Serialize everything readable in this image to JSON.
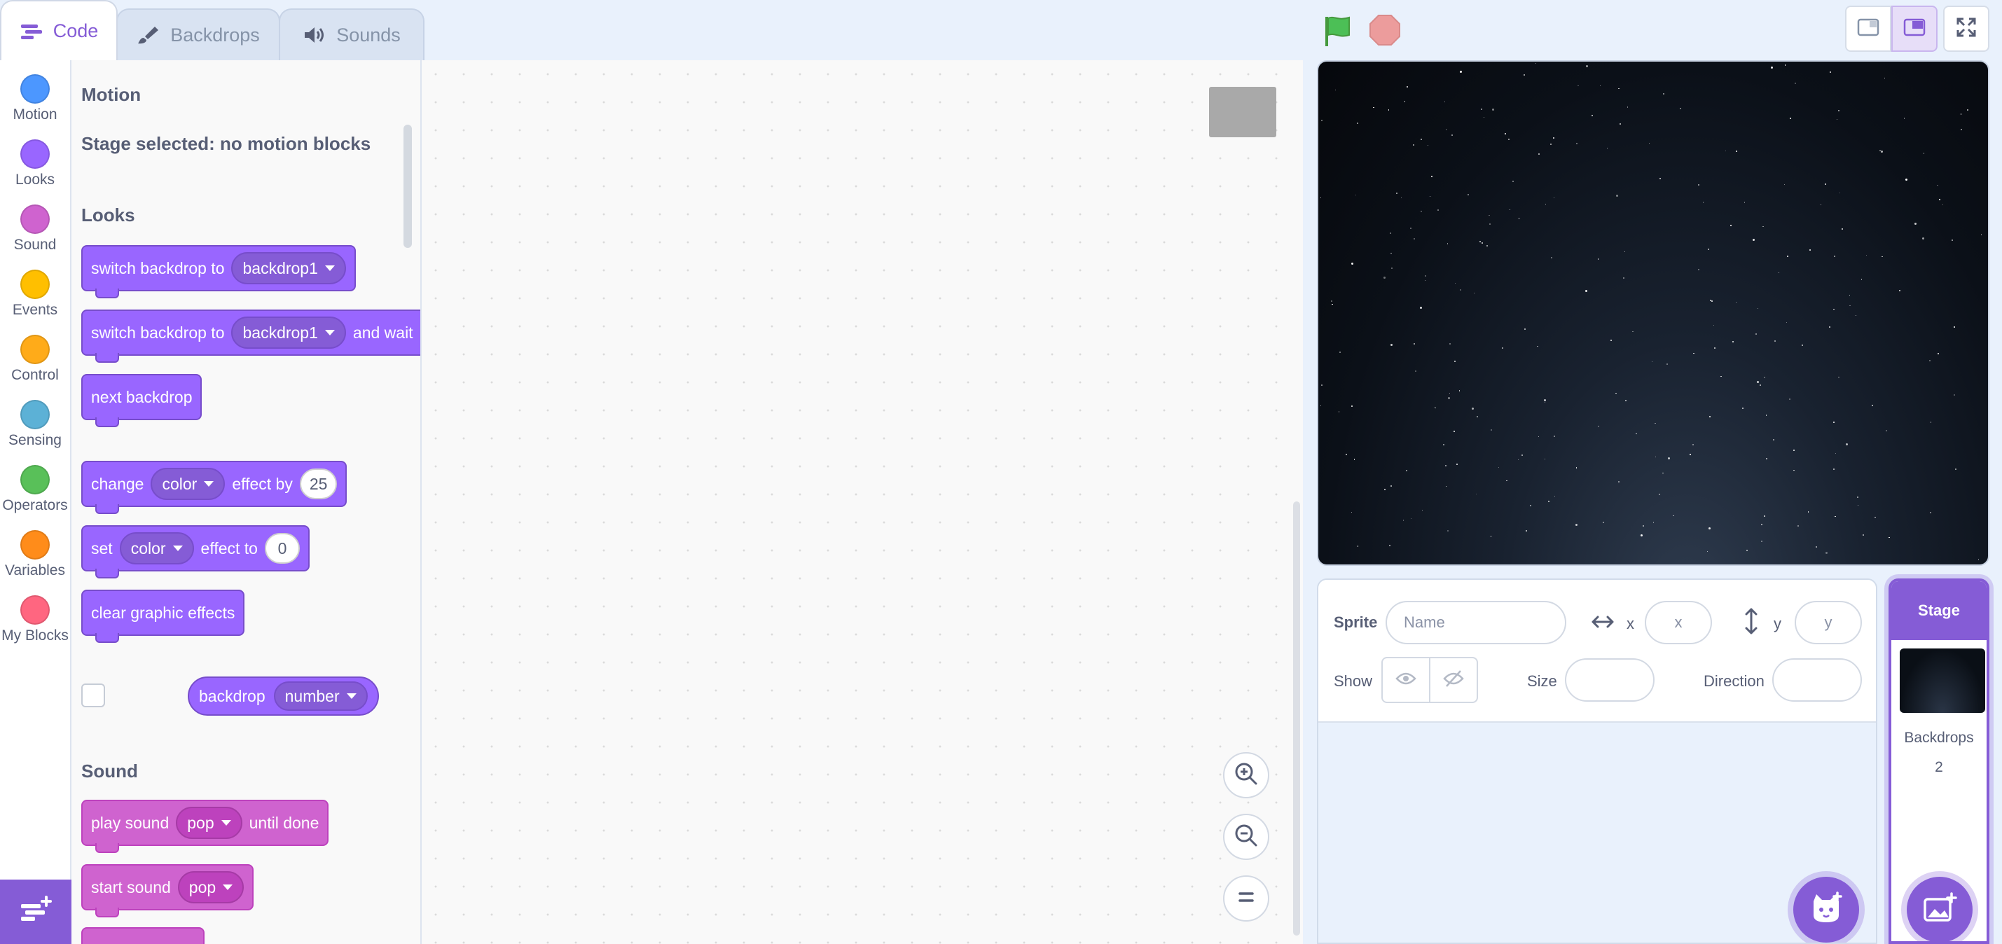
{
  "tabs": [
    {
      "label": "Code",
      "icon": "code-icon"
    },
    {
      "label": "Backdrops",
      "icon": "brush-icon"
    },
    {
      "label": "Sounds",
      "icon": "speaker-icon"
    }
  ],
  "categories": [
    {
      "label": "Motion",
      "color": "#4c97ff"
    },
    {
      "label": "Looks",
      "color": "#9966ff"
    },
    {
      "label": "Sound",
      "color": "#cf63cf"
    },
    {
      "label": "Events",
      "color": "#ffbf00"
    },
    {
      "label": "Control",
      "color": "#ffab19"
    },
    {
      "label": "Sensing",
      "color": "#5cb1d6"
    },
    {
      "label": "Operators",
      "color": "#59c059"
    },
    {
      "label": "Variables",
      "color": "#ff8c1a"
    },
    {
      "label": "My Blocks",
      "color": "#ff6680"
    }
  ],
  "palette": {
    "motion_title": "Motion",
    "motion_note": "Stage selected: no motion blocks",
    "looks_title": "Looks",
    "sound_title": "Sound",
    "blocks": {
      "switch_backdrop": {
        "text": "switch backdrop to",
        "menu": "backdrop1"
      },
      "switch_backdrop_wait": {
        "text": "switch backdrop to",
        "menu": "backdrop1",
        "suffix": "and wait"
      },
      "next_backdrop": {
        "text": "next backdrop"
      },
      "change_effect": {
        "text": "change",
        "menu": "color",
        "mid": "effect by",
        "value": "25"
      },
      "set_effect": {
        "text": "set",
        "menu": "color",
        "mid": "effect to",
        "value": "0"
      },
      "clear_effects": {
        "text": "clear graphic effects"
      },
      "backdrop_reporter": {
        "text": "backdrop",
        "menu": "number"
      },
      "play_sound": {
        "text": "play sound",
        "menu": "pop",
        "suffix": "until done"
      },
      "start_sound": {
        "text": "start sound",
        "menu": "pop"
      }
    }
  },
  "sprite_info": {
    "sprite_label": "Sprite",
    "name_placeholder": "Name",
    "x_label": "x",
    "x_placeholder": "x",
    "y_label": "y",
    "y_placeholder": "y",
    "show_label": "Show",
    "size_label": "Size",
    "direction_label": "Direction"
  },
  "stage_pane": {
    "title": "Stage",
    "backdrops_label": "Backdrops",
    "backdrops_count": "2"
  },
  "colors": {
    "accent": "#855cd6",
    "looks": "#9966ff",
    "sound": "#cf63cf",
    "flag": "#4cbf56",
    "stop": "#ec9c9c"
  }
}
